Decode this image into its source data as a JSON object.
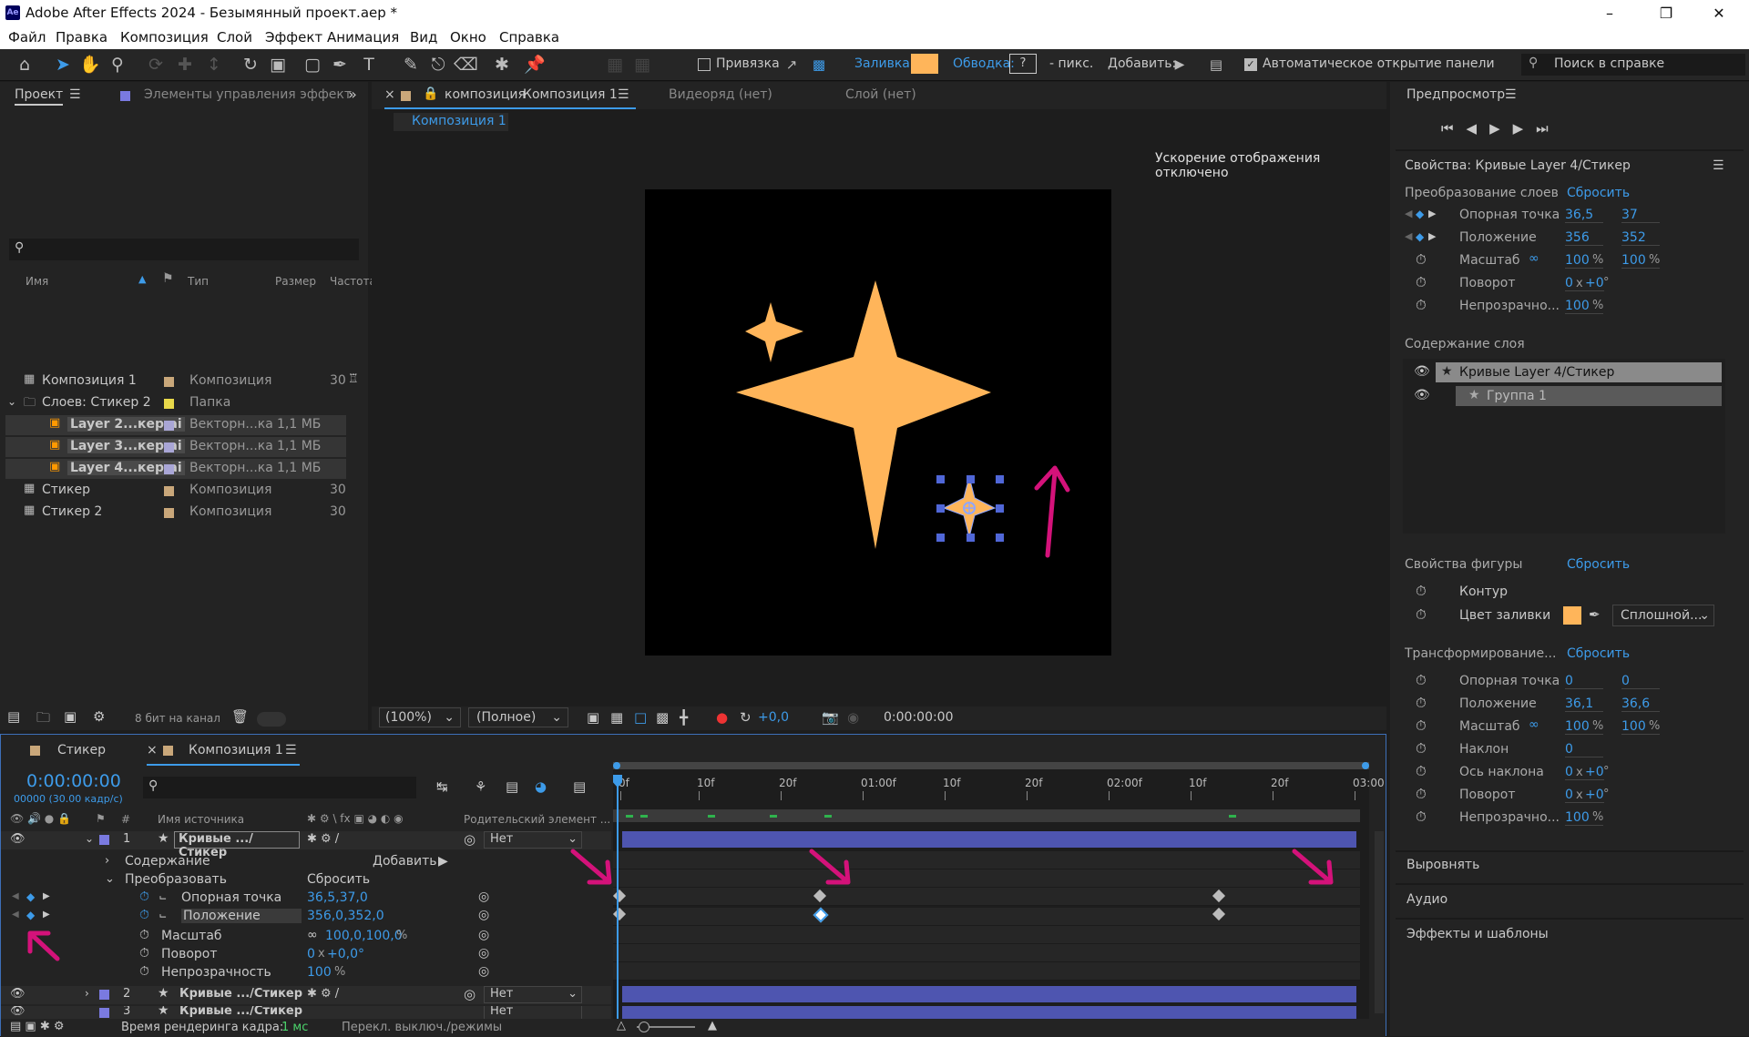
{
  "window": {
    "title": "Adobe After Effects 2024 - Безымянный проект.aep *",
    "app_badge": "Ae"
  },
  "menu": [
    "Файл",
    "Правка",
    "Композиция",
    "Слой",
    "Эффект",
    "Анимация",
    "Вид",
    "Окно",
    "Справка"
  ],
  "toolbar": {
    "snap_label": "Привязка",
    "fill_label": "Заливка:",
    "stroke_label": "Обводка:",
    "stroke_value": "?",
    "px_label": "- пикс.",
    "add_label": "Добавить:",
    "auto_open_label": "Автоматическое открытие панели",
    "search_placeholder": "Поиск в справке",
    "fill_color": "#ffb55a"
  },
  "project_panel": {
    "tab": "Проект",
    "tab2": "Элементы управления эффект",
    "cols": {
      "name": "Имя",
      "type": "Тип",
      "size": "Размер",
      "rate": "Частота"
    },
    "items": [
      {
        "name": "Композиция 1",
        "color": "#c9a77a",
        "type": "Композиция",
        "size": "",
        "rate": "30"
      },
      {
        "name": "Слоев: Стикер 2",
        "color": "#e8d84a",
        "type": "Папка",
        "size": "",
        "rate": ""
      },
      {
        "name": "Layer 2...кер.ai",
        "color": "#a9a6d6",
        "type": "Векторн...ка",
        "size": "1,1 МБ",
        "rate": ""
      },
      {
        "name": "Layer 3...кер.ai",
        "color": "#a9a6d6",
        "type": "Векторн...ка",
        "size": "1,1 МБ",
        "rate": ""
      },
      {
        "name": "Layer 4...кер.ai",
        "color": "#a9a6d6",
        "type": "Векторн...ка",
        "size": "1,1 МБ",
        "rate": ""
      },
      {
        "name": "Стикер",
        "color": "#c9a77a",
        "type": "Композиция",
        "size": "",
        "rate": "30"
      },
      {
        "name": "Стикер 2",
        "color": "#c9a77a",
        "type": "Композиция",
        "size": "",
        "rate": "30"
      }
    ],
    "bpc": "8 бит на канал"
  },
  "comp_panel": {
    "tab_prefix": "композиция",
    "tab_name": "Композиция 1",
    "footage_tab": "Видеоряд  (нет)",
    "layer_tab": "Слой  (нет)",
    "sub_tab": "Композиция 1",
    "accel_msg": "Ускорение отображения отключено",
    "zoom": "(100%)",
    "quality": "(Полное)",
    "exposure": "+0,0",
    "timecode": "0:00:00:00",
    "star_color": "#ffb55a"
  },
  "timeline": {
    "tabs": [
      "Стикер",
      "Композиция 1"
    ],
    "timecode": "0:00:00:00",
    "fps": "00000 (30.00 кадр/с)",
    "col_source": "Имя источника",
    "col_parent": "Родительский элемент ...",
    "ruler": [
      "0f",
      "10f",
      "20f",
      "01:00f",
      "10f",
      "20f",
      "02:00f",
      "10f",
      "20f",
      "03:00"
    ],
    "layers": [
      {
        "num": "1",
        "name": "Кривые .../Стикер",
        "parent": "Нет"
      },
      {
        "num": "2",
        "name": "Кривые .../Стикер",
        "parent": "Нет"
      },
      {
        "num": "3",
        "name": "Кривые .../Стикер",
        "parent": "Нет"
      }
    ],
    "contents": "Содержание",
    "add": "Добавить:",
    "transform": "Преобразовать",
    "reset": "Сбросить",
    "props": [
      {
        "name": "Опорная точка",
        "value": "36,5,37,0"
      },
      {
        "name": "Положение",
        "value": "356,0,352,0"
      },
      {
        "name": "Масштаб",
        "value": "100,0,100,0",
        "suffix": "%"
      },
      {
        "name": "Поворот",
        "value": "0",
        "suffix": "x",
        "value2": "+0,0°"
      },
      {
        "name": "Непрозрачность",
        "value": "100",
        "suffix": "%"
      }
    ],
    "status_render": "Время рендеринга кадра:",
    "status_ms": "1 мс",
    "status_toggle": "Перекл. выключ./режимы"
  },
  "right_panel": {
    "preview": "Предпросмотр",
    "props_title": "Свойства: Кривые Layer 4/Стикер",
    "layer_transform": "Преобразование слоев",
    "reset": "Сбросить",
    "lt": [
      {
        "name": "Опорная точка",
        "v1": "36,5",
        "v2": "37"
      },
      {
        "name": "Положение",
        "v1": "356",
        "v2": "352"
      },
      {
        "name": "Масштаб",
        "v1": "100",
        "v2": "100",
        "pct": "%"
      },
      {
        "name": "Поворот",
        "v1": "0",
        "x": "x",
        "v2": "+0",
        "deg": "°"
      },
      {
        "name": "Непрозрачно...",
        "v1": "100",
        "pct": "%"
      }
    ],
    "layer_content": "Содержание слоя",
    "content_items": [
      "Кривые Layer 4/Стикер",
      "Группа 1"
    ],
    "shape_props": "Свойства фигуры",
    "contour": "Контур",
    "fill_color": "Цвет заливки",
    "fill_mode": "Сплошной...",
    "shape_transform": "Трансформирование...",
    "st": [
      {
        "name": "Опорная точка",
        "v1": "0",
        "v2": "0"
      },
      {
        "name": "Положение",
        "v1": "36,1",
        "v2": "36,6"
      },
      {
        "name": "Масштаб",
        "v1": "100",
        "v2": "100",
        "pct": "%"
      },
      {
        "name": "Наклон",
        "v1": "0"
      },
      {
        "name": "Ось наклона",
        "v1": "0",
        "x": "x",
        "v2": "+0",
        "deg": "°"
      },
      {
        "name": "Поворот",
        "v1": "0",
        "x": "x",
        "v2": "+0",
        "deg": "°"
      },
      {
        "name": "Непрозрачно...",
        "v1": "100",
        "pct": "%"
      }
    ],
    "align": "Выровнять",
    "audio": "Аудио",
    "effects": "Эффекты и шаблоны"
  }
}
